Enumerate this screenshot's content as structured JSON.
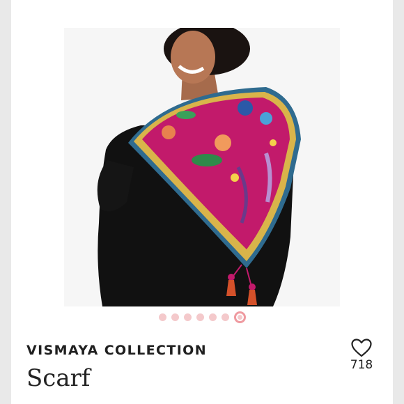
{
  "listing": {
    "brand": "VISMAYA COLLECTION",
    "title": "Scarf",
    "like_count": "718"
  },
  "carousel": {
    "total_images": 7,
    "active_index": 6
  },
  "colors": {
    "accent_pink": "#ef9aa0",
    "dot_inactive": "#f4c9cb",
    "scarf_magenta": "#c21a6b"
  },
  "icons": {
    "like": "heart-outline-icon"
  }
}
